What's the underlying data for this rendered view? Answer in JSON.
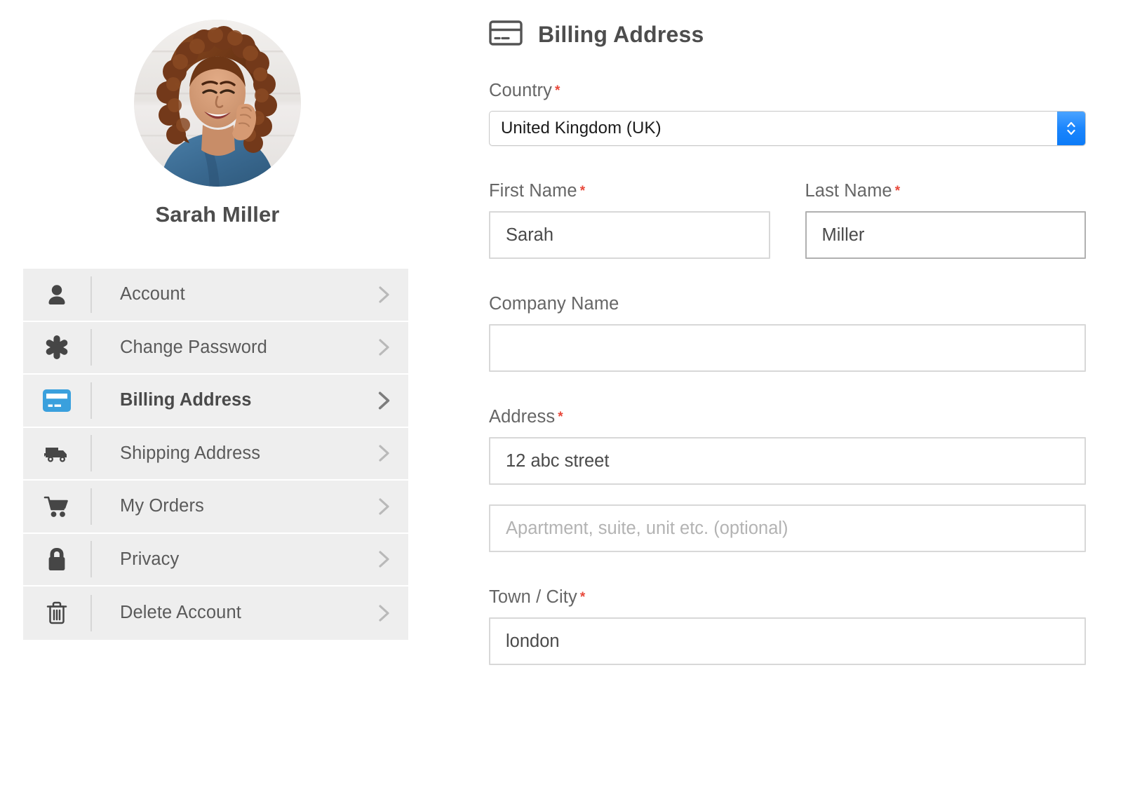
{
  "profile": {
    "name": "Sarah Miller",
    "avatar_alt": "profile-photo-woman-curly-hair"
  },
  "sidebar": {
    "items": [
      {
        "label": "Account",
        "icon": "person-icon",
        "active": false
      },
      {
        "label": "Change Password",
        "icon": "asterisk-icon",
        "active": false
      },
      {
        "label": "Billing Address",
        "icon": "credit-card-icon",
        "active": true
      },
      {
        "label": "Shipping Address",
        "icon": "truck-icon",
        "active": false
      },
      {
        "label": "My Orders",
        "icon": "cart-icon",
        "active": false
      },
      {
        "label": "Privacy",
        "icon": "lock-icon",
        "active": false
      },
      {
        "label": "Delete Account",
        "icon": "trash-icon",
        "active": false
      }
    ]
  },
  "panel": {
    "title": "Billing Address",
    "icon": "credit-card-icon",
    "required_marker": "*",
    "fields": {
      "country": {
        "label": "Country",
        "required": true,
        "value": "United Kingdom (UK)"
      },
      "first_name": {
        "label": "First Name",
        "required": true,
        "value": "Sarah",
        "placeholder": ""
      },
      "last_name": {
        "label": "Last Name",
        "required": true,
        "value": "Miller",
        "placeholder": ""
      },
      "company_name": {
        "label": "Company Name",
        "required": false,
        "value": "",
        "placeholder": ""
      },
      "address": {
        "label": "Address",
        "required": true,
        "value": "12 abc street",
        "placeholder": ""
      },
      "address2": {
        "label": "",
        "required": false,
        "value": "",
        "placeholder": "Apartment, suite, unit etc. (optional)"
      },
      "town_city": {
        "label": "Town / City",
        "required": true,
        "value": "london",
        "placeholder": ""
      }
    }
  },
  "colors": {
    "accent_blue": "#3498db",
    "stepper_blue": "#0d7bf7",
    "required_red": "#e8483a",
    "menu_bg": "#eeeeee",
    "text_dark": "#4a4a4a"
  }
}
